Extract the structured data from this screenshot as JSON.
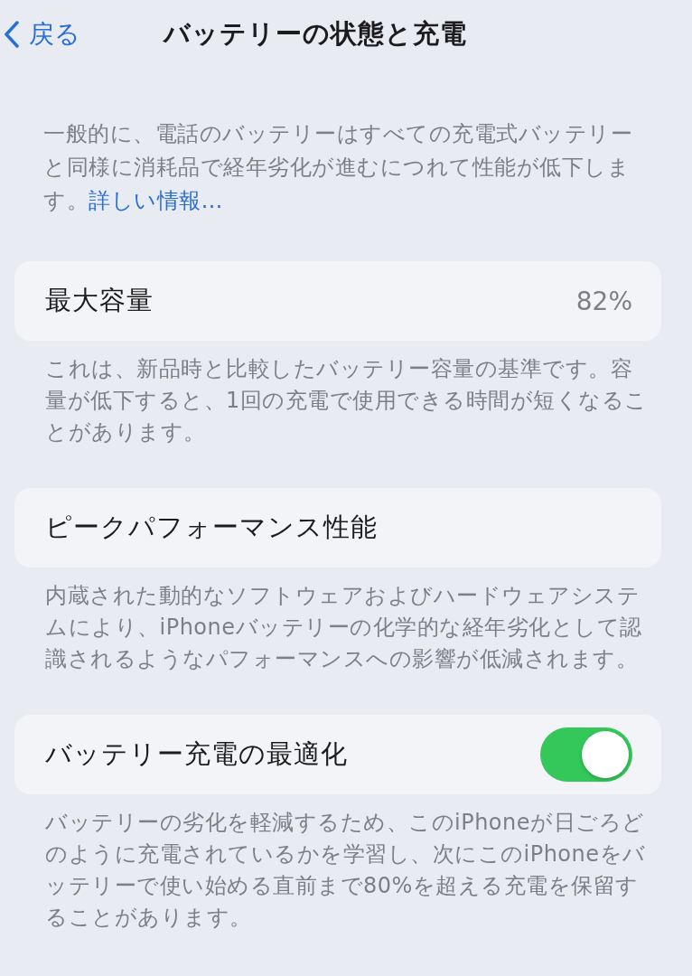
{
  "nav": {
    "back_label": "戻る",
    "title": "バッテリーの状態と充電"
  },
  "intro": {
    "text": "一般的に、電話のバッテリーはすべての充電式バッテリーと同様に消耗品で経年劣化が進むにつれて性能が低下します。",
    "link": "詳しい情報…"
  },
  "sections": [
    {
      "kind": "value",
      "label": "最大容量",
      "value": "82%",
      "footer": "これは、新品時と比較したバッテリー容量の基準です。容量が低下すると、1回の充電で使用できる時間が短くなることがあります。"
    },
    {
      "kind": "plain",
      "label": "ピークパフォーマンス性能",
      "footer": "内蔵された動的なソフトウェアおよびハードウェアシステムにより、iPhoneバッテリーの化学的な経年劣化として認識されるようなパフォーマンスへの影響が低減されます。"
    },
    {
      "kind": "toggle",
      "label": "バッテリー充電の最適化",
      "on": true,
      "footer": "バッテリーの劣化を軽減するため、このiPhoneが日ごろどのように充電されているかを学習し、次にこのiPhoneをバッテリーで使い始める直前まで80%を超える充電を保留することがあります。"
    }
  ]
}
